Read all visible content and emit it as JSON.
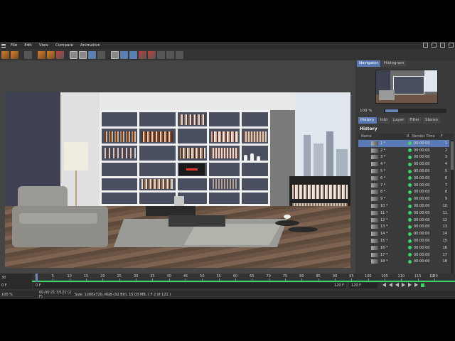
{
  "menu": [
    "File",
    "Edit",
    "View",
    "Compare",
    "Animation"
  ],
  "right_panel": {
    "top_tabs": [
      "Navigator",
      "Histogram"
    ],
    "zoom": "100 %",
    "tabs": [
      "History",
      "Info",
      "Layer",
      "Filter",
      "Stereo"
    ],
    "history_title": "History",
    "columns": {
      "name": "Name",
      "r": "R",
      "render_time": "Render Time",
      "f": "F"
    },
    "rows": [
      {
        "name": "1 *",
        "time": "00:00:00",
        "f": "1"
      },
      {
        "name": "2 *",
        "time": "00:00:00",
        "f": "2"
      },
      {
        "name": "3 *",
        "time": "00:00:00",
        "f": "3"
      },
      {
        "name": "4 *",
        "time": "00:00:00",
        "f": "4"
      },
      {
        "name": "5 *",
        "time": "00:00:00",
        "f": "5"
      },
      {
        "name": "6 *",
        "time": "00:00:00",
        "f": "6"
      },
      {
        "name": "7 *",
        "time": "00:00:00",
        "f": "7"
      },
      {
        "name": "8 *",
        "time": "00:00:00",
        "f": "8"
      },
      {
        "name": "9 *",
        "time": "00:00:00",
        "f": "9"
      },
      {
        "name": "10 *",
        "time": "00:00:00",
        "f": "10"
      },
      {
        "name": "11 *",
        "time": "00:00:00",
        "f": "11"
      },
      {
        "name": "12 *",
        "time": "00:00:00",
        "f": "12"
      },
      {
        "name": "13 *",
        "time": "00:00:00",
        "f": "13"
      },
      {
        "name": "14 *",
        "time": "00:00:00",
        "f": "14"
      },
      {
        "name": "15 *",
        "time": "00:00:00",
        "f": "15"
      },
      {
        "name": "16 *",
        "time": "00:00:00",
        "f": "16"
      },
      {
        "name": "17 *",
        "time": "00:00:00",
        "f": "17"
      },
      {
        "name": "18 *",
        "time": "00:00:00",
        "f": "18"
      }
    ]
  },
  "timeline": {
    "current_frame": "30",
    "ticks": [
      "0",
      "5",
      "10",
      "15",
      "20",
      "25",
      "30",
      "35",
      "40",
      "45",
      "50",
      "55",
      "60",
      "65",
      "70",
      "75",
      "80",
      "85",
      "90",
      "95",
      "100",
      "105",
      "110",
      "115",
      "120"
    ],
    "end_label": "1 F",
    "start_field": "0 F",
    "range_start": "0 F",
    "range_end": "120 F",
    "end_field": "120 F"
  },
  "status": {
    "zoom": "100 %",
    "time": "00:00:21 3/121 (2 F)",
    "info": "Size: 1280x720, RGB (32 Bit), 15.03 MB,  ( F 2 of 121 )"
  },
  "colors": {
    "accent": "#5a7ab5",
    "ok": "#3bd66b"
  }
}
